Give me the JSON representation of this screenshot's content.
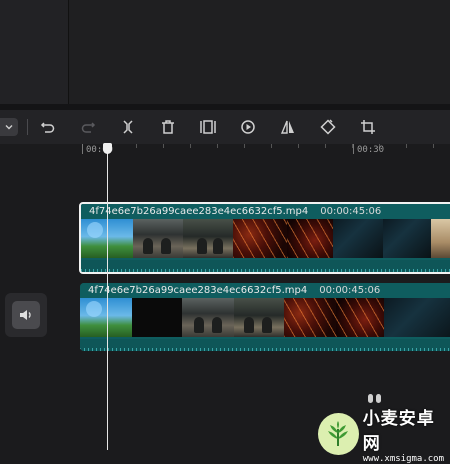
{
  "ruler": {
    "start_label": "00:00",
    "mark_label": "00:30"
  },
  "tracks": [
    {
      "filename": "4f74e6e7b26a99caee283e4ec6632cf5.mp4",
      "duration": "00:00:45:06",
      "selected": true,
      "thumbs": [
        "sky",
        "people",
        "people2",
        "fire",
        "fire2",
        "night",
        "night2",
        "bright"
      ]
    },
    {
      "filename": "4f74e6e7b26a99caee283e4ec6632cf5.mp4",
      "duration": "00:00:45:06",
      "selected": false,
      "thumbs": [
        "sky",
        "dark",
        "people",
        "people2",
        "fire",
        "fire2",
        "night"
      ]
    }
  ],
  "toolbar": {
    "icons": [
      "dropdown-icon",
      "undo-icon",
      "redo-icon",
      "split-icon",
      "delete-icon",
      "freeze-frame-icon",
      "play-speed-icon",
      "mirror-icon",
      "rotate-icon",
      "crop-icon"
    ]
  },
  "watermark": {
    "name": "小麦安卓网",
    "url": "www.xmsigma.com"
  },
  "colors": {
    "track": "#0f5d5f",
    "background": "#1b1b1d",
    "toolbar": "#232326"
  }
}
